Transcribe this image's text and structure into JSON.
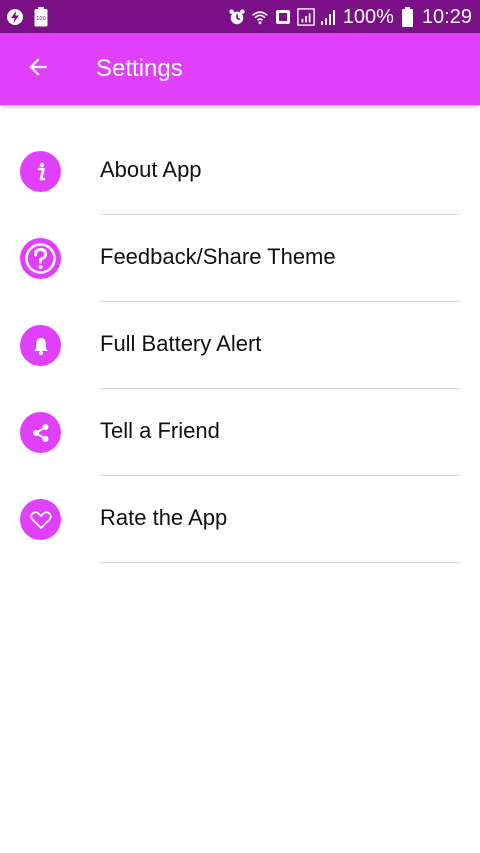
{
  "status_bar": {
    "battery_percent": "100%",
    "time": "10:29",
    "small_badge": "100"
  },
  "toolbar": {
    "title": "Settings"
  },
  "colors": {
    "status_bar": "#7a0f86",
    "accent": "#e040fb",
    "divider": "#d6d6d6"
  },
  "settings_items": [
    {
      "label": "About App",
      "icon": "info-icon"
    },
    {
      "label": "Feedback/Share Theme",
      "icon": "help-circle-icon"
    },
    {
      "label": "Full Battery Alert",
      "icon": "bell-icon"
    },
    {
      "label": "Tell a Friend",
      "icon": "share-icon"
    },
    {
      "label": "Rate the App",
      "icon": "heart-icon"
    }
  ]
}
